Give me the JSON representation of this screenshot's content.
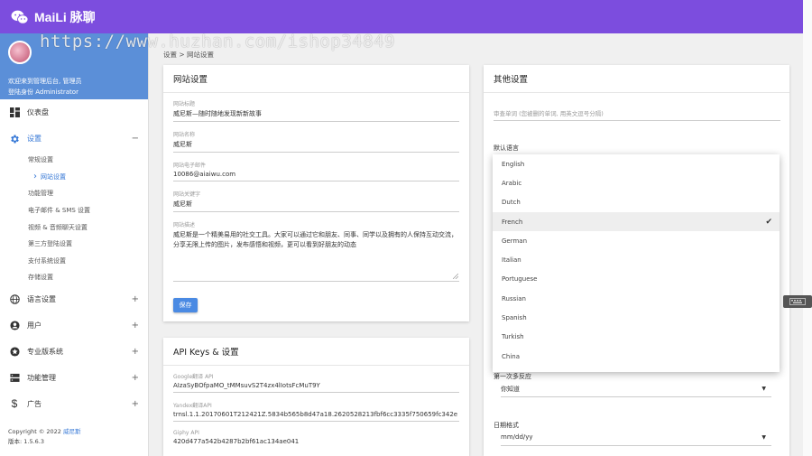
{
  "app": {
    "brand": "MaiLi 脉聊"
  },
  "watermark": "https://www.huzhan.com/ishop34849",
  "profile": {
    "welcome": "欢迎来到管理后台, 管理员",
    "role": "登陆身份 Administrator"
  },
  "sidebar": {
    "dashboard": "仪表盘",
    "settings": "设置",
    "settings_toggle": "−",
    "sub_items": [
      "常规设置",
      "网站设置",
      "功能管理",
      "电子邮件 & SMS 设置",
      "视频 & 音频聊天设置",
      "第三方登陆设置",
      "支付系统设置",
      "存储设置"
    ],
    "languages": "语言设置",
    "users": "用户",
    "pro": "专业版系统",
    "manage": "功能管理",
    "ads": "广告",
    "plus": "+"
  },
  "footer": {
    "copyright": "Copyright © 2022 ",
    "company": "威尼斯",
    "version": "版本: 1.5.6.3"
  },
  "breadcrumb": "设置 > 网站设置",
  "site_card": {
    "title": "网站设置",
    "fields": [
      {
        "label": "网站标题",
        "value": "威尼斯—随时随地发现新新故事"
      },
      {
        "label": "网站名称",
        "value": "威尼斯"
      },
      {
        "label": "网站电子邮件",
        "value": "10086@aiaiwu.com"
      },
      {
        "label": "网站关键字",
        "value": "威尼斯"
      },
      {
        "label": "网站描述",
        "value": "威尼斯是一个精美易用的社交工具。大家可以通过它和朋友、同事、同学以及拥有的人保持互动交流，分享无限上传的图片，发布感悟和视频，更可以看到好朋友的动态"
      }
    ],
    "save": "保存"
  },
  "api_card": {
    "title": "API Keys & 设置",
    "fields": [
      {
        "label": "Google翻译 API",
        "value": "AIzaSyBOfpaMO_tMMsuvS2T4zx4lIotsFcMuT9Y"
      },
      {
        "label": "Yandex翻译API",
        "value": "trnsl.1.1.20170601T212421Z.5834b565b8d47a18.2620528213fbf6cc3335f750659fc342e"
      },
      {
        "label": "Giphy API",
        "value": "420d477a542b4287b2bf61ac134ae041"
      }
    ]
  },
  "other_card": {
    "title": "其他设置",
    "censor_placeholder": "审查单词 (您被删的单词, 用英文逗号分隔)",
    "default_lang_label": "默认语言",
    "first_response_label": "第一次多反应",
    "first_response_value": "你知道",
    "date_label": "日期格式",
    "date_value": "mm/dd/yy"
  },
  "dropdown": {
    "options": [
      "English",
      "Arabic",
      "Dutch",
      "French",
      "German",
      "Italian",
      "Portuguese",
      "Russian",
      "Spanish",
      "Turkish",
      "China"
    ],
    "selected": "French"
  },
  "side_tab": "▭▭▭"
}
